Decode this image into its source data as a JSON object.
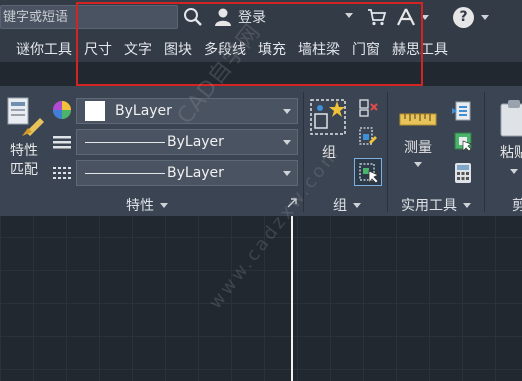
{
  "search": {
    "placeholder": "键字或短语"
  },
  "user": {
    "login_label": "登录"
  },
  "tabs": [
    "谜你工具",
    "尺寸",
    "文字",
    "图块",
    "多段线",
    "填充",
    "墙柱梁",
    "门窗",
    "赫思工具"
  ],
  "properties_panel": {
    "match_label_line1": "特性",
    "match_label_line2": "匹配",
    "color_value": "ByLayer",
    "linetype_value": "ByLayer",
    "lineweight_value": "ByLayer",
    "title": "特性"
  },
  "group_panel": {
    "group_label": "组",
    "title": "组"
  },
  "utilities_panel": {
    "measure_label": "测量",
    "title": "实用工具"
  },
  "clipboard_panel": {
    "paste_label": "粘贴",
    "title_partial": "剪"
  },
  "watermark": {
    "line1": "CAD自学网",
    "line2": "www.cadzxw.com"
  },
  "colors": {
    "highlight": "#d32323",
    "ribbon_bg": "#3b4453",
    "canvas_bg": "#212830"
  }
}
